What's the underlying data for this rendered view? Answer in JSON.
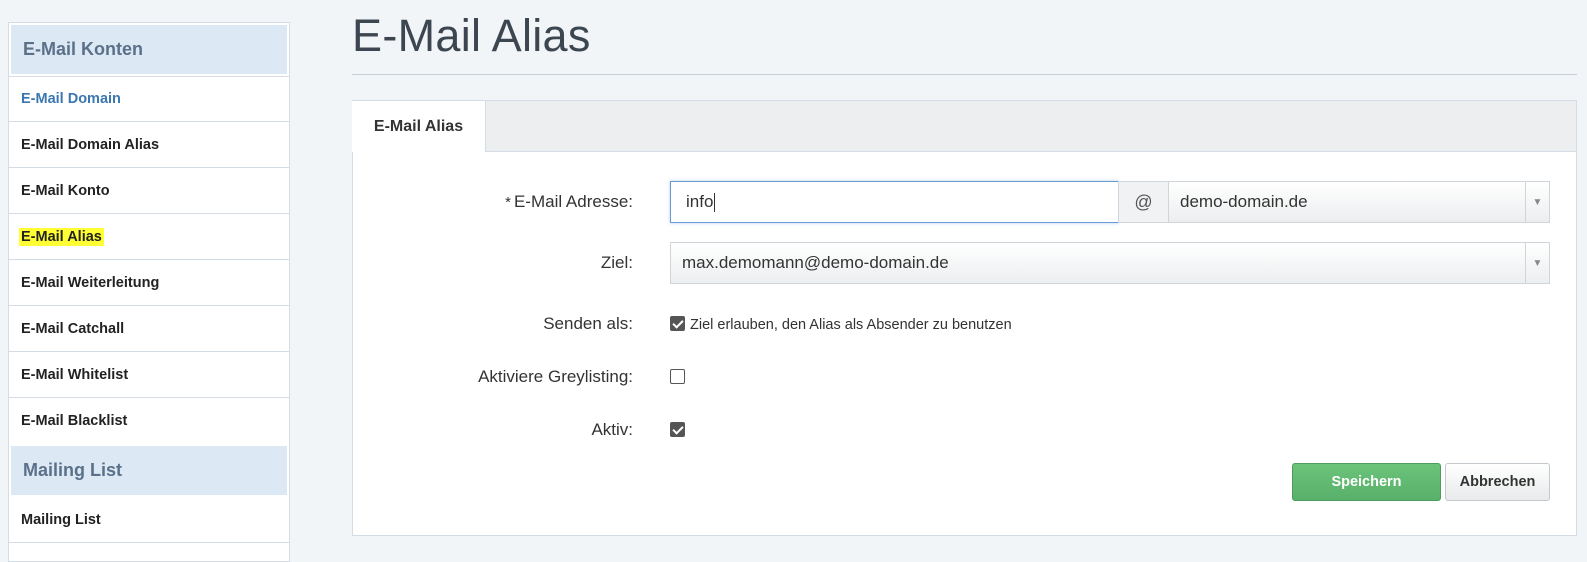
{
  "sidebar": {
    "section1": "E-Mail Konten",
    "items": [
      {
        "label": "E-Mail Domain"
      },
      {
        "label": "E-Mail Domain Alias"
      },
      {
        "label": "E-Mail Konto"
      },
      {
        "label": "E-Mail Alias"
      },
      {
        "label": "E-Mail Weiterleitung"
      },
      {
        "label": "E-Mail Catchall"
      },
      {
        "label": "E-Mail Whitelist"
      },
      {
        "label": "E-Mail Blacklist"
      }
    ],
    "section2": "Mailing List",
    "items2": [
      {
        "label": "Mailing List"
      }
    ]
  },
  "page": {
    "title": "E-Mail Alias"
  },
  "panel": {
    "tab": "E-Mail Alias",
    "form": {
      "email": {
        "required_mark": "*",
        "label": "E-Mail Adresse:",
        "value": "info",
        "at": "@",
        "domain": "demo-domain.de"
      },
      "ziel": {
        "label": "Ziel:",
        "value": "max.demomann@demo-domain.de"
      },
      "senden_als": {
        "label": "Senden als:",
        "checked": true,
        "checkbox_label": "Ziel erlauben, den Alias als Absender zu benutzen"
      },
      "greylisting": {
        "label": "Aktiviere Greylisting:",
        "checked": false
      },
      "aktiv": {
        "label": "Aktiv:",
        "checked": true
      }
    },
    "buttons": {
      "save": "Speichern",
      "cancel": "Abbrechen"
    }
  },
  "colors": {
    "link": "#3a77b0",
    "highlight": "#ffff33",
    "save_button": "#5cb85c",
    "sidebar_header": "#dde8f5"
  }
}
